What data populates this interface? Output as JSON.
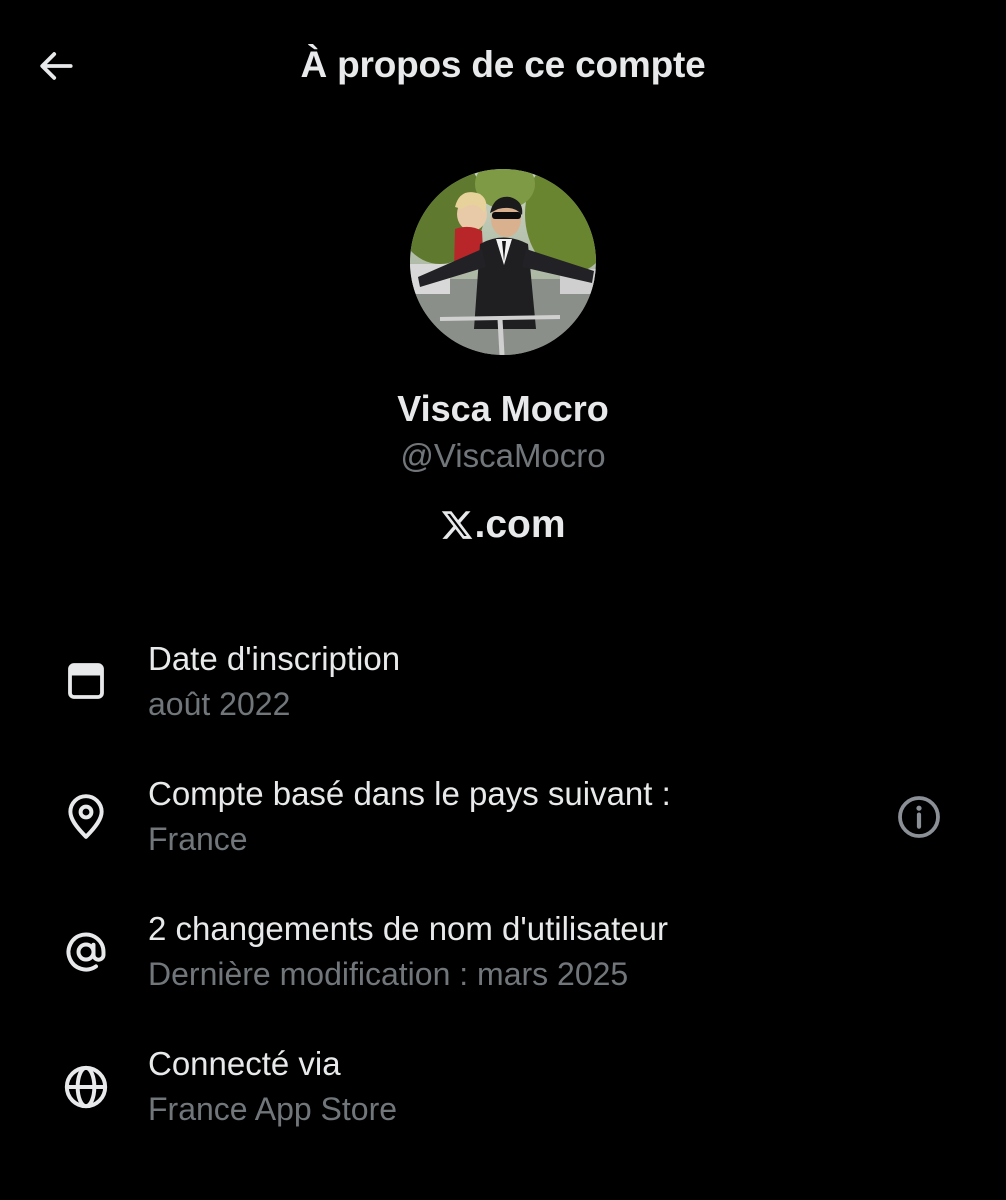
{
  "header": {
    "title": "À propos de ce compte",
    "back_icon": "arrow-left-icon"
  },
  "profile": {
    "display_name": "Visca Mocro",
    "handle": "@ViscaMocro",
    "brand_logo": "x-logo-icon",
    "brand_suffix": ".com"
  },
  "details": [
    {
      "icon": "calendar-icon",
      "title": "Date d'inscription",
      "subtitle": "août 2022"
    },
    {
      "icon": "location-pin-icon",
      "title": "Compte basé dans le pays suivant :",
      "subtitle": "France",
      "action_icon": "info-icon"
    },
    {
      "icon": "at-sign-icon",
      "title": "2 changements de nom d'utilisateur",
      "subtitle": "Dernière modification : mars 2025"
    },
    {
      "icon": "globe-icon",
      "title": "Connecté via",
      "subtitle": "France App Store"
    }
  ],
  "colors": {
    "background": "#000000",
    "primary_text": "#e7e9ea",
    "secondary_text": "#71767b"
  }
}
